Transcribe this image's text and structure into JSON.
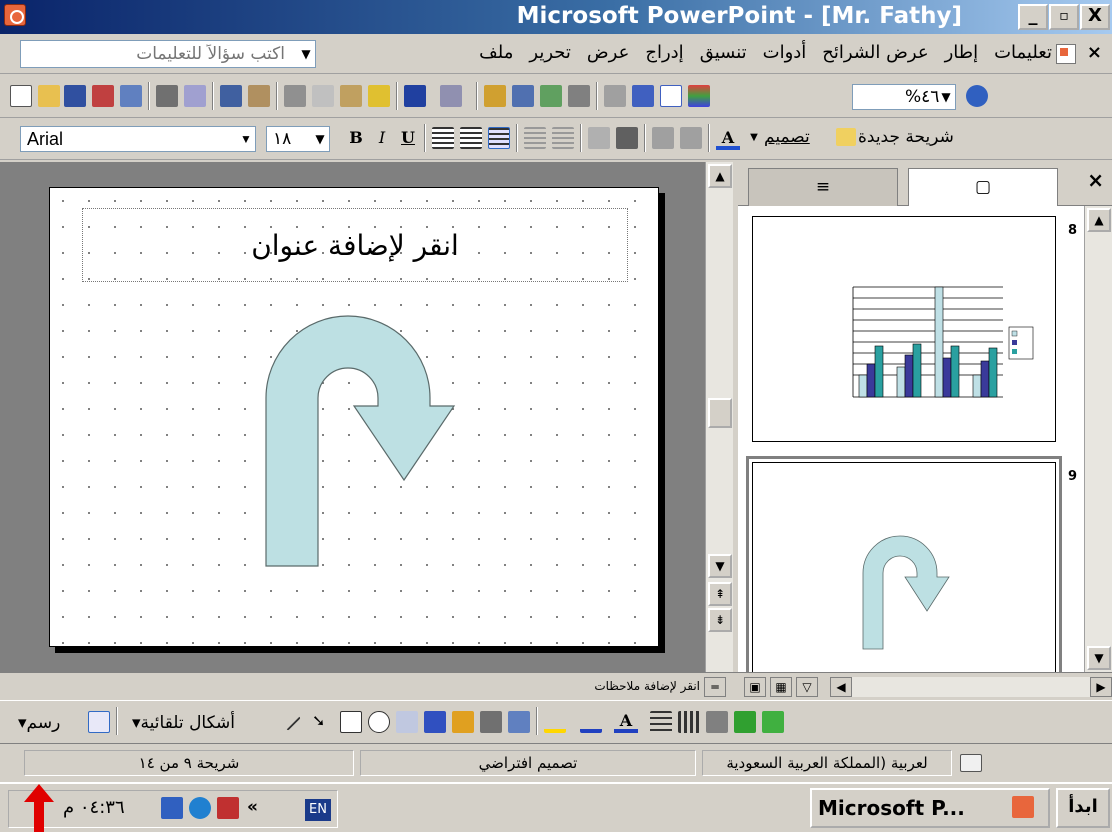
{
  "window": {
    "title": "Microsoft PowerPoint - [Mr. Fathy]",
    "minimize": "_",
    "maximize": "▫",
    "close": "X"
  },
  "menubar": {
    "items": [
      "ملف",
      "تحرير",
      "عرض",
      "إدراج",
      "تنسيق",
      "أدوات",
      "عرض الشرائح",
      "إطار",
      "تعليمات"
    ],
    "help_placeholder": "اكتب سؤالاً للتعليمات",
    "close": "×"
  },
  "standard_toolbar": {
    "zoom": "%٤٦"
  },
  "formatting_toolbar": {
    "font": "Arial",
    "font_size": "١٨",
    "bold": "B",
    "italic": "I",
    "underline": "U",
    "font_color_glyph": "A",
    "design_label": "تصميم",
    "new_slide_label": "شريحة جديدة"
  },
  "slide": {
    "title_placeholder": "انقر لإضافة عنوان"
  },
  "panel": {
    "tabs": [
      "outline",
      "slides"
    ],
    "close": "×",
    "thumbnails": [
      {
        "number": "8"
      },
      {
        "number": "9"
      }
    ]
  },
  "notes": {
    "placeholder": "انقر لإضافة ملاحظات"
  },
  "drawing_toolbar": {
    "draw_label": "رسم",
    "autoshapes_label": "أشكال تلقائية"
  },
  "status": {
    "slide_position": "شريحة ٩ من ١٤",
    "design": "تصميم افتراضي",
    "language": "لعربية (المملكة العربية السعودية"
  },
  "taskbar": {
    "clock": "٠٤:٣٦ م",
    "lang": "EN",
    "task": "Microsoft P...",
    "start": "ابدأ",
    "more": "»"
  },
  "colors": {
    "title_gradient_start": "#0a246a",
    "arrow_fill": "#bde0e3",
    "arrow_stroke": "#5a6a6a",
    "chart_bar_1": "#bfe0e6",
    "chart_bar_2": "#3a3a9a",
    "chart_bar_3": "#2aa0a0",
    "red_arrow": "#e00000"
  }
}
